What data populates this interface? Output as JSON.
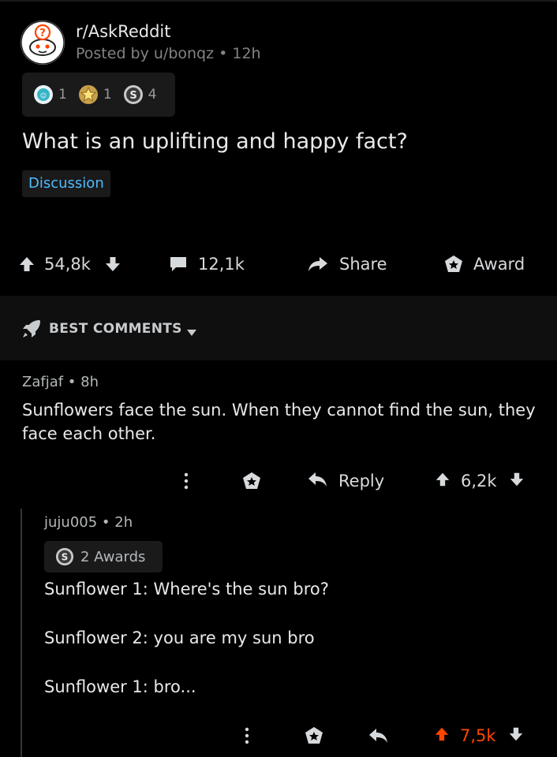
{
  "post": {
    "subreddit": "r/AskReddit",
    "posted_by": "Posted by u/bonqz • 12h",
    "awards": [
      {
        "icon": "helpful-award-icon",
        "count": "1"
      },
      {
        "icon": "star-award-icon",
        "count": "1"
      },
      {
        "icon": "silver-award-icon",
        "count": "4"
      }
    ],
    "title": "What is an uplifting and happy fact?",
    "flair": "Discussion",
    "upvotes": "54,8k",
    "comments": "12,1k",
    "share_label": "Share",
    "award_label": "Award"
  },
  "sort": {
    "label": "BEST COMMENTS"
  },
  "comments": [
    {
      "author_time": "Zafjaf • 8h",
      "body": "Sunflowers face the sun.  When they cannot find the sun, they face each other.",
      "reply_label": "Reply",
      "score": "6,2k"
    },
    {
      "author_time": "juju005 • 2h",
      "awards_label": "2 Awards",
      "lines": [
        "Sunflower 1: Where's the sun bro?",
        "Sunflower 2: you are my sun bro",
        "Sunflower 1: bro..."
      ],
      "score": "7,5k"
    }
  ],
  "colors": {
    "background": "#000000",
    "upvote_active": "#ff4500",
    "flair_text": "#4fbdff",
    "muted": "#818384"
  }
}
